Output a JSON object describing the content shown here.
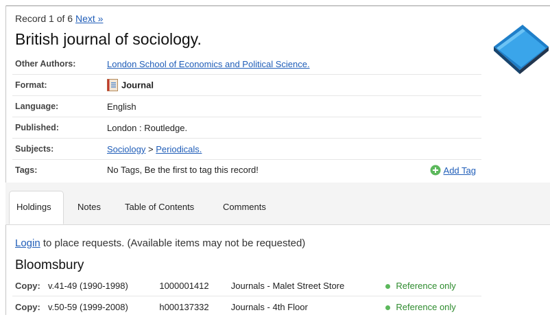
{
  "record_nav": {
    "text": "Record 1 of 6",
    "next_label": "Next »"
  },
  "title": "British journal of sociology.",
  "details": {
    "other_authors": {
      "label": "Other Authors:",
      "value": "London School of Economics and Political Science."
    },
    "format": {
      "label": "Format:",
      "value": "Journal"
    },
    "language": {
      "label": "Language:",
      "value": "English"
    },
    "published": {
      "label": "Published:",
      "value": "London : Routledge."
    },
    "subjects": {
      "label": "Subjects:",
      "subject": "Sociology",
      "separator": ">",
      "subheading": "Periodicals."
    },
    "tags": {
      "label": "Tags:",
      "value": "No Tags, Be the first to tag this record!",
      "add_label": "Add Tag"
    }
  },
  "tabs": [
    {
      "label": "Holdings",
      "active": true
    },
    {
      "label": "Notes",
      "active": false
    },
    {
      "label": "Table of Contents",
      "active": false
    },
    {
      "label": "Comments",
      "active": false
    }
  ],
  "holdings": {
    "login_link": "Login",
    "login_rest": " to place requests. (Available items may not be requested)",
    "library": "Bloomsbury",
    "copy_label": "Copy:",
    "copies": [
      {
        "volumes": "v.41-49 (1990-1998)",
        "barcode": "1000001412",
        "location": "Journals - Malet Street Store",
        "status": "Reference only"
      },
      {
        "volumes": "v.50-59 (1999-2008)",
        "barcode": "h000137332",
        "location": "Journals - 4th Floor",
        "status": "Reference only"
      }
    ]
  },
  "colors": {
    "link": "#1f5db8",
    "status_green": "#2e8b2e",
    "book_blue": "#2a8fd6"
  },
  "icons": {
    "book": "book-icon",
    "format": "journal-icon",
    "add": "plus-circle-icon",
    "status": "status-dot-icon"
  }
}
